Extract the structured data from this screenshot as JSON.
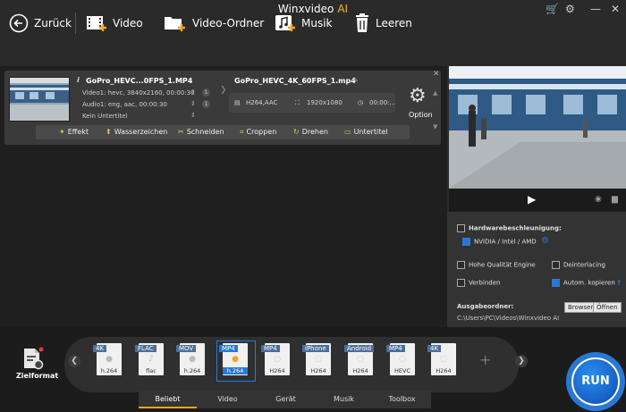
{
  "app": {
    "title": "Winxvideo",
    "title_ai": "AI"
  },
  "toolbar": {
    "back": "Zurück",
    "video": "Video",
    "video_folder": "Video-Ordner",
    "music": "Musik",
    "clear": "Leeren"
  },
  "item": {
    "source_name": "GoPro_HEVC...0FPS_1.MP4",
    "video_track": "Video1: hevc, 3840x2160, 00:00:30",
    "audio_track": "Audio1: eng, aac, 00:00:30",
    "subtitle": "Kein Untertitel",
    "video_badge": "1",
    "audio_badge": "1",
    "output_name": "GoPro_HEVC_4K_60FPS_1.mp4",
    "codec": "H264,AAC",
    "resolution": "1920x1080",
    "duration": "00:00:...",
    "option_label": "Option"
  },
  "edit_bar": [
    "Effekt",
    "Wasserzeichen",
    "Schneiden",
    "Croppen",
    "Drehen",
    "Untertitel"
  ],
  "options": {
    "hw_accel": "Hardwarebeschleunigung:",
    "gpu": "NVIDIA / Intel / AMD",
    "high_quality": "Hohe Qualität Engine",
    "deinterlacing": "Deinterlacing",
    "merge": "Verbinden",
    "auto_copy": "Autom. kopieren",
    "help": "?"
  },
  "output": {
    "label": "Ausgabeordner:",
    "path": "C:\\Users\\PC\\Videos\\Winxvideo AI",
    "browse": "Browsen",
    "open": "Öffnen"
  },
  "formats": [
    {
      "tag": "4K",
      "label": "h.264"
    },
    {
      "tag": "FLAC",
      "label": "flac"
    },
    {
      "tag": "MOV",
      "label": "h.264"
    },
    {
      "tag": "MP4",
      "label": "h.264",
      "selected": true
    },
    {
      "tag": "MP4",
      "label": "H264"
    },
    {
      "tag": "iPhone",
      "label": "H264"
    },
    {
      "tag": "Android",
      "label": "H264"
    },
    {
      "tag": "MP4",
      "label": "HEVC"
    },
    {
      "tag": "4K",
      "label": "H264"
    }
  ],
  "zielformat": "Zielformat",
  "tabs": [
    "Beliebt",
    "Video",
    "Gerät",
    "Musik",
    "Toolbox"
  ],
  "run": "RUN",
  "colors": {
    "accent": "#f5a623",
    "blue": "#2a78d6"
  }
}
